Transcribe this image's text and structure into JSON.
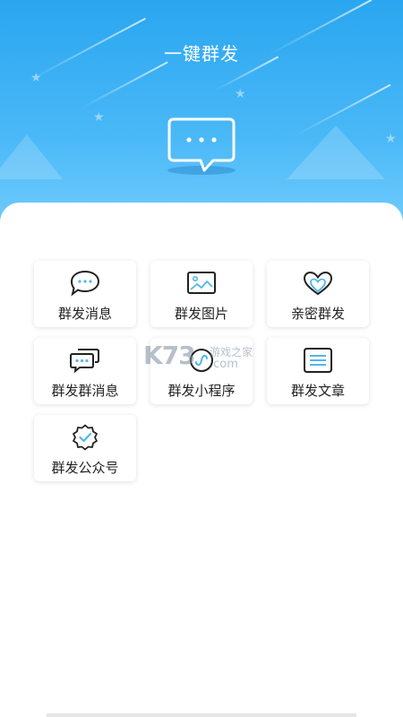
{
  "header": {
    "title": "一键群发",
    "bubble_icon": "chat-bubble-icon"
  },
  "tiles": [
    {
      "label": "群发消息",
      "icon": "message-bubble-icon"
    },
    {
      "label": "群发图片",
      "icon": "image-icon"
    },
    {
      "label": "亲密群发",
      "icon": "heart-icon"
    },
    {
      "label": "群发群消息",
      "icon": "group-chat-icon"
    },
    {
      "label": "群发小程序",
      "icon": "mini-program-icon"
    },
    {
      "label": "群发文章",
      "icon": "article-icon"
    },
    {
      "label": "群发公众号",
      "icon": "official-account-icon"
    }
  ],
  "watermark": {
    "brand": "K73",
    "tagline": "游戏之家",
    "domain": ".com"
  },
  "colors": {
    "header_top": "#2aa6f0",
    "header_bottom": "#6fcbfb",
    "icon_accent": "#4fb8e8",
    "text": "#222222"
  }
}
